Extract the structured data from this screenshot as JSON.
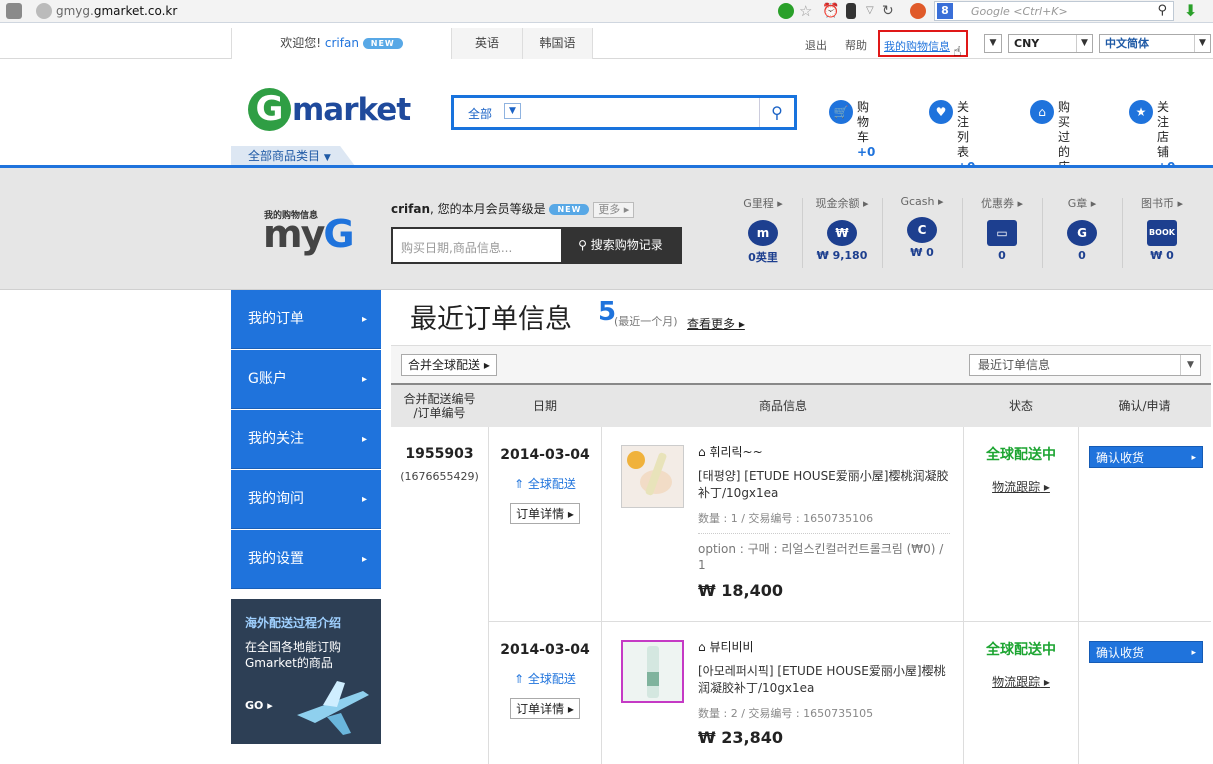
{
  "browser": {
    "url_prefix": "gmyg.",
    "url_domain": "gmarket.co.kr",
    "search_placeholder": "Google <Ctrl+K>",
    "search_engine_letter": "8"
  },
  "topbar": {
    "welcome": "欢迎您!",
    "username": "crifan",
    "new_badge": "NEW",
    "tabs": [
      "英语",
      "韩国语"
    ],
    "logout": "退出",
    "help": "帮助",
    "my_shopping": "我的购物信息",
    "currency": "CNY",
    "language": "中文简体"
  },
  "header": {
    "logo_g": "G",
    "logo_text": "market",
    "search_category": "全部",
    "nav": [
      {
        "label": "购物车",
        "count": "+0",
        "icon": "cart-icon"
      },
      {
        "label": "关注列表",
        "count": "+0",
        "icon": "heart-icon"
      },
      {
        "label1": "购买过的",
        "label2": "店铺",
        "count": "+4",
        "icon": "home-icon"
      },
      {
        "label1": "关注店",
        "label2": "铺",
        "count": "+0",
        "icon": "star-icon"
      }
    ],
    "all_categories": "全部商品类目"
  },
  "myg": {
    "small_title": "我的购物信息",
    "big_my": "my",
    "big_g": "G",
    "greeting_user": "crifan",
    "greeting_text": ", 您的本月会员等级是",
    "greeting_badge": "NEW",
    "more": "更多",
    "search_placeholder": "购买日期,商品信息...",
    "search_button": "搜索购物记录",
    "stats": [
      {
        "title": "G里程",
        "glyph": "m",
        "value": "0英里"
      },
      {
        "title": "现金余额",
        "glyph": "₩",
        "value": "₩ 9,180"
      },
      {
        "title": "Gcash",
        "glyph": "C",
        "value": "₩ 0"
      },
      {
        "title": "优惠券",
        "glyph": "▭",
        "value": "0"
      },
      {
        "title": "G章",
        "glyph": "G",
        "value": "0"
      },
      {
        "title": "图书币",
        "glyph": "BOOK",
        "value": "₩ 0"
      }
    ]
  },
  "sidebar": {
    "items": [
      "我的订单",
      "G账户",
      "我的关注",
      "我的询问",
      "我的设置"
    ],
    "promo_title": "海外配送过程介绍",
    "promo_line1": "在全国各地能订购",
    "promo_line2": "Gmarket的商品",
    "promo_go": "GO"
  },
  "orders": {
    "title": "最近订单信息",
    "count": "5",
    "period": "(最近一个月)",
    "more": "查看更多",
    "merge_button": "合并全球配送",
    "recent_select": "最近订单信息",
    "columns": [
      "合并配送编号\n/订单编号",
      "日期",
      "商品信息",
      "状态",
      "确认/申请"
    ],
    "order_no": "1955903",
    "order_sub": "(1676655429)",
    "rows": [
      {
        "date": "2014-03-04",
        "global": "全球配送",
        "detail": "订单详情",
        "shop": "휘리릭~~",
        "name": "[태평양] [ETUDE HOUSE爱丽小屋]樱桃润凝胶补丁/10gx1ea",
        "qty": "数量 : 1 / 交易编号 : 1650735106",
        "option": "option : 구매 : 리얼스킨컬러컨트롤크림 (₩0) / 1",
        "price": "₩ 18,400",
        "status": "全球配送中",
        "track": "物流跟踪",
        "confirm": "确认收货"
      },
      {
        "date": "2014-03-04",
        "global": "全球配送",
        "detail": "订单详情",
        "shop": "뷰티비비",
        "name": "[아모레퍼시픽] [ETUDE HOUSE爱丽小屋]樱桃润凝胶补丁/10gx1ea",
        "qty": "数量 : 2 / 交易编号 : 1650735105",
        "option": "",
        "price": "₩ 23,840",
        "status": "全球配送中",
        "track": "物流跟踪",
        "confirm": "确认收货"
      }
    ]
  },
  "colors": {
    "brand_blue": "#1f73dc",
    "green": "#1da532",
    "dark": "#2d3f55"
  }
}
